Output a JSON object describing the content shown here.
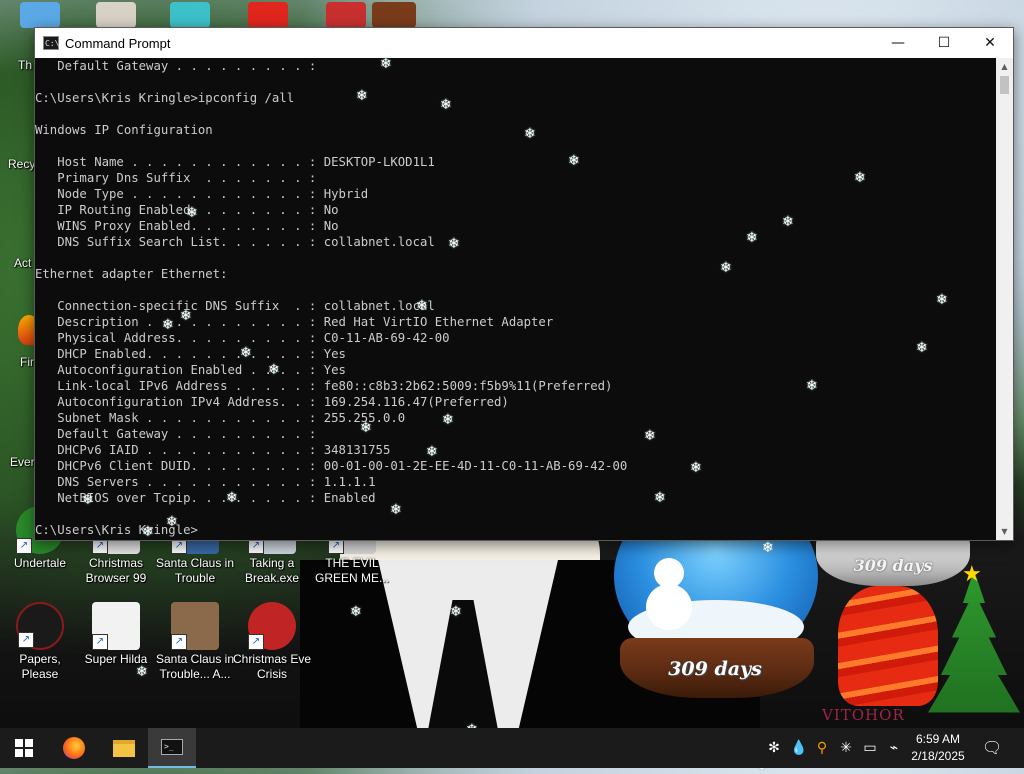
{
  "window": {
    "title": "Command Prompt",
    "controls": {
      "minimize": "—",
      "maximize": "☐",
      "close": "✕"
    },
    "app_icon": "C:\\"
  },
  "console": {
    "lines": [
      "   Default Gateway . . . . . . . . . :",
      "",
      "C:\\Users\\Kris Kringle>ipconfig /all",
      "",
      "Windows IP Configuration",
      "",
      "   Host Name . . . . . . . . . . . . : DESKTOP-LKOD1L1",
      "   Primary Dns Suffix  . . . . . . . :",
      "   Node Type . . . . . . . . . . . . : Hybrid",
      "   IP Routing Enabled. . . . . . . . : No",
      "   WINS Proxy Enabled. . . . . . . . : No",
      "   DNS Suffix Search List. . . . . . : collabnet.local",
      "",
      "Ethernet adapter Ethernet:",
      "",
      "   Connection-specific DNS Suffix  . : collabnet.local",
      "   Description . . . . . . . . . . . : Red Hat VirtIO Ethernet Adapter",
      "   Physical Address. . . . . . . . . : C0-11-AB-69-42-00",
      "   DHCP Enabled. . . . . . . . . . . : Yes",
      "   Autoconfiguration Enabled . . . . : Yes",
      "   Link-local IPv6 Address . . . . . : fe80::c8b3:2b62:5009:f5b9%11(Preferred)",
      "   Autoconfiguration IPv4 Address. . : 169.254.116.47(Preferred)",
      "   Subnet Mask . . . . . . . . . . . : 255.255.0.0",
      "   Default Gateway . . . . . . . . . :",
      "   DHCPv6 IAID . . . . . . . . . . . : 348131755",
      "   DHCPv6 Client DUID. . . . . . . . : 00-01-00-01-2E-EE-4D-11-C0-11-AB-69-42-00",
      "   DNS Servers . . . . . . . . . . . : 1.1.1.1",
      "   NetBIOS over Tcpip. . . . . . . . : Enabled",
      "",
      "C:\\Users\\Kris Kringle>"
    ]
  },
  "desktop": {
    "edge_labels": [
      "Th",
      "Recy",
      "Act",
      "Fir",
      "Ever"
    ],
    "icons": [
      {
        "label": "Undertale",
        "color": "#2a8a2a"
      },
      {
        "label": "Christmas Browser 99",
        "color": "#e8e8e8"
      },
      {
        "label": "Santa Claus in Trouble",
        "color": "#3a6aa8"
      },
      {
        "label": "Taking a Break.exe",
        "color": "#cfd8e0"
      },
      {
        "label": "THE EVIL GREEN ME...",
        "color": "#d8d8d8"
      },
      {
        "label": "Papers, Please",
        "color": "#1a1a1a"
      },
      {
        "label": "Super Hilda",
        "color": "#f2f2f2"
      },
      {
        "label": "Santa Claus in Trouble... A...",
        "color": "#8a6a4a"
      },
      {
        "label": "Christmas Eve Crisis",
        "color": "#c02424"
      }
    ],
    "snow_globe_right_days": "309 days",
    "snow_globe_left_days": "309 days",
    "watermark": "VITOHOR"
  },
  "taskbar": {
    "buttons": [
      {
        "name": "start",
        "icon": "windows-icon"
      },
      {
        "name": "firefox",
        "icon": "firefox-icon"
      },
      {
        "name": "file-explorer",
        "icon": "folder-icon"
      },
      {
        "name": "command-prompt",
        "icon": "terminal-icon"
      }
    ],
    "tray_icons": [
      "people-icon",
      "drop-icon",
      "magnifier-icon",
      "snowflake-icon",
      "network-icon",
      "power-icon",
      "volume-icon"
    ],
    "time": "6:59 AM",
    "date": "2/18/2025",
    "notification_icon": "notification-icon"
  },
  "colors": {
    "console_bg": "#0c0c0c",
    "console_text": "#cccccc",
    "taskbar_bg": "#1b1b1b",
    "accent": "#76b9ed"
  }
}
